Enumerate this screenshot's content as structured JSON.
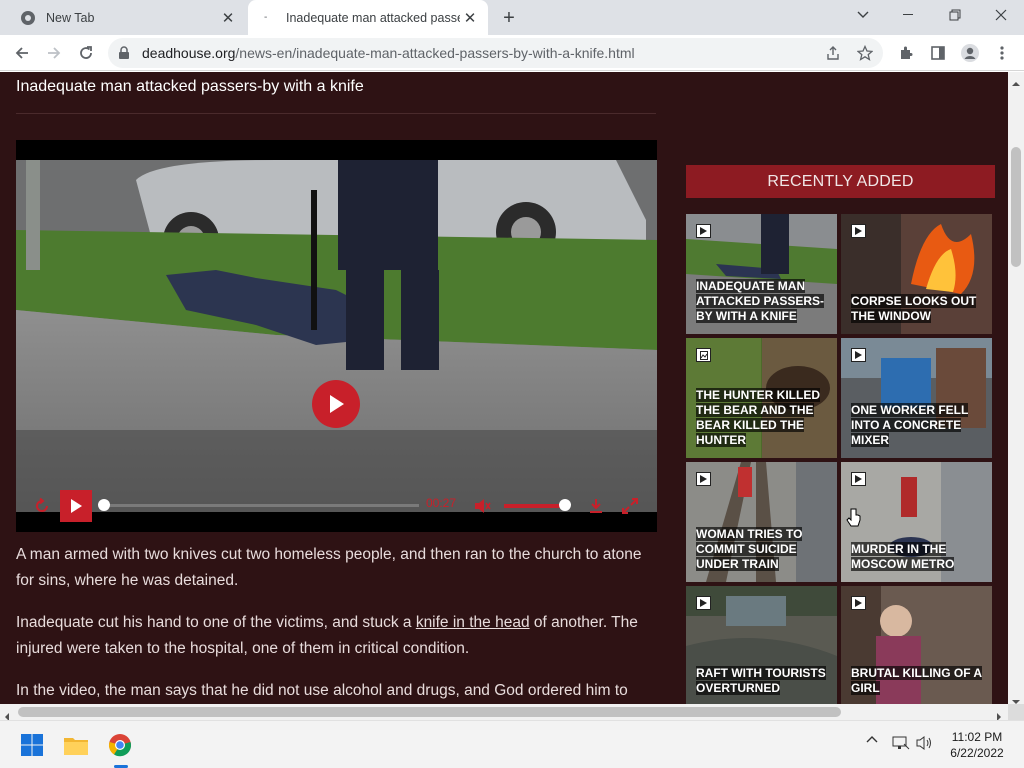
{
  "browser": {
    "tabs": [
      {
        "title": "New Tab"
      },
      {
        "title": "Inadequate man attacked passers"
      }
    ],
    "url_host": "deadhouse.org",
    "url_path": "/news-en/inadequate-man-attacked-passers-by-with-a-knife.html"
  },
  "article": {
    "title": "Inadequate man attacked passers-by with a knife",
    "video": {
      "time": "00:27"
    },
    "paragraphs": {
      "p1": "A man armed with two knives cut two homeless people, and then ran to the church to atone for sins, where he was detained.",
      "p2_before": "Inadequate cut his hand to one of the victims, and stuck a ",
      "p2_link": "knife in the head",
      "p2_after": " of another. The injured were taken to the hospital, one of them in critical condition.",
      "p3": "In the video, the man says that he did not use alcohol and drugs, and God ordered him to"
    }
  },
  "sidebar": {
    "header": "RECENTLY ADDED",
    "items": [
      {
        "title": "Inadequate man attacked passers-by with a knife",
        "icon": "video-icon"
      },
      {
        "title": "Corpse looks out the window",
        "icon": "video-icon"
      },
      {
        "title": "The hunter killed the bear and the bear killed the hunter",
        "icon": "image-icon"
      },
      {
        "title": "One worker fell into a concrete mixer",
        "icon": "video-icon"
      },
      {
        "title": "Woman tries to commit suicide under train",
        "icon": "video-icon"
      },
      {
        "title": "Murder in the Moscow metro",
        "icon": "video-icon"
      },
      {
        "title": "Raft with tourists overturned",
        "icon": "video-icon"
      },
      {
        "title": "Brutal killing of a girl",
        "icon": "video-icon"
      }
    ]
  },
  "taskbar": {
    "time": "11:02 PM",
    "date": "6/22/2022"
  },
  "colors": {
    "page_bg": "#2e1214",
    "accent": "#c8202a",
    "header_bg": "#8d1b22"
  }
}
